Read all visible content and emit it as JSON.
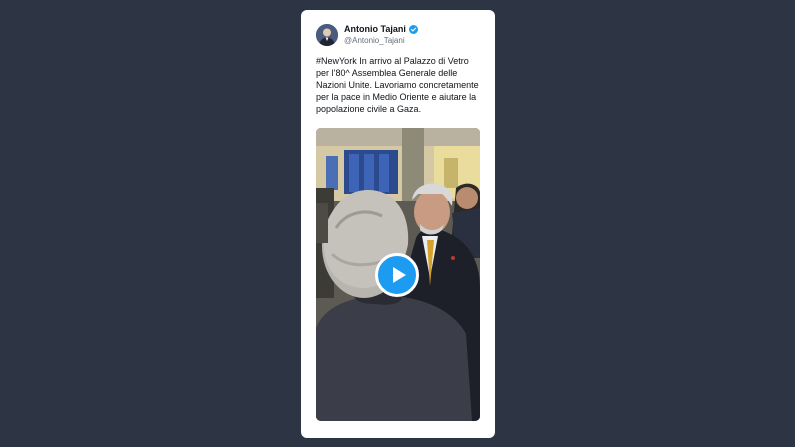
{
  "tweet": {
    "author": {
      "name": "Antonio Tajani",
      "handle": "@Antonio_Tajani",
      "verified": true,
      "avatar_icon": "avatar-photo"
    },
    "text": "#NewYork In arrivo al Palazzo di Vetro per l’80^ Assemblea Generale delle Nazioni Unite. Lavoriamo concretamente per la pace in Medio Oriente e aiutare la popolazione civile a Gaza.",
    "media": {
      "type": "video",
      "play_icon": "play-icon"
    }
  },
  "colors": {
    "background": "#2d3544",
    "card": "#ffffff",
    "accent": "#1d9bf0",
    "text": "#0f1419",
    "muted": "#66707a"
  }
}
